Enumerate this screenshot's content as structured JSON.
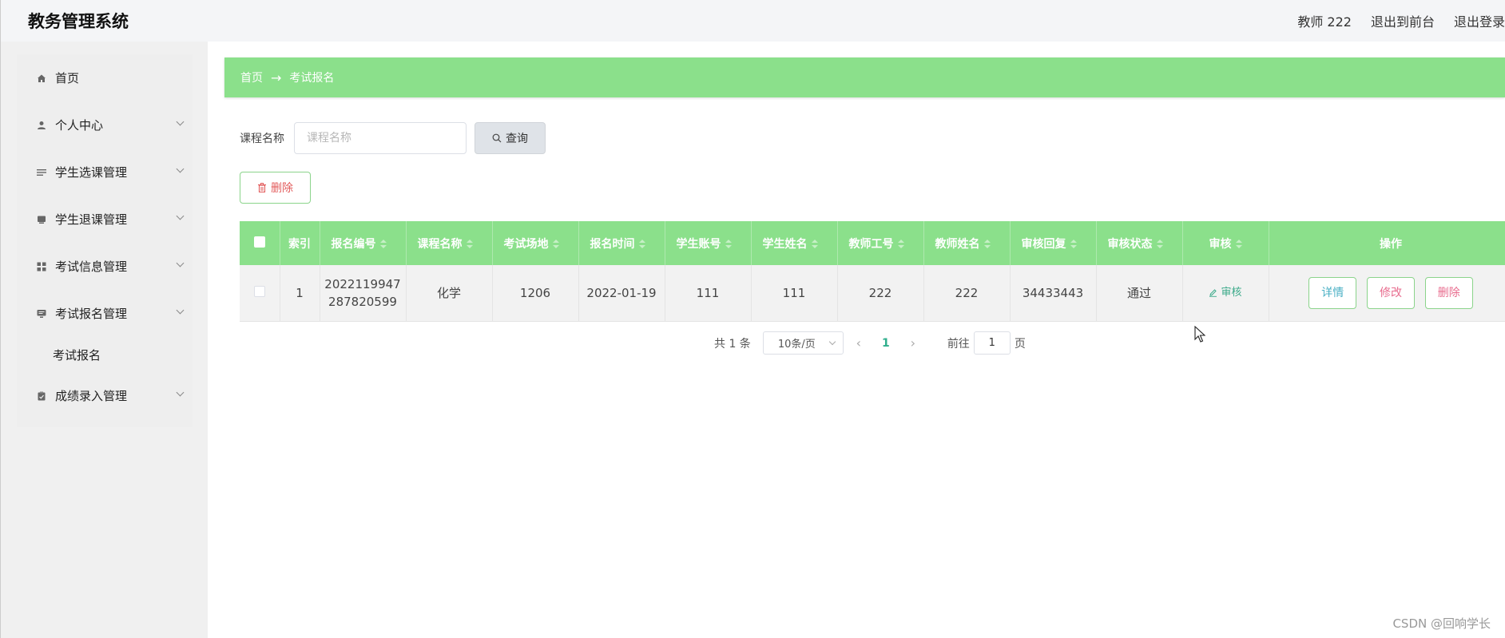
{
  "app": {
    "title": "教务管理系统",
    "user": "教师 222",
    "back_to_front": "退出到前台",
    "logout": "退出登录"
  },
  "sidebar": {
    "items": [
      {
        "label": "首页",
        "icon": "home-icon"
      },
      {
        "label": "个人中心",
        "icon": "user-icon"
      },
      {
        "label": "学生选课管理",
        "icon": "list-icon"
      },
      {
        "label": "学生退课管理",
        "icon": "box-icon"
      },
      {
        "label": "考试信息管理",
        "icon": "grid-icon"
      },
      {
        "label": "考试报名管理",
        "icon": "monitor-icon"
      },
      {
        "label": "考试报名"
      },
      {
        "label": "成绩录入管理",
        "icon": "clipboard-icon"
      }
    ]
  },
  "breadcrumb": {
    "home": "首页",
    "arrow": "→",
    "current": "考试报名"
  },
  "search": {
    "label": "课程名称",
    "placeholder": "课程名称",
    "button": "查询"
  },
  "toolbar": {
    "delete_label": "删除"
  },
  "table": {
    "headers": [
      "索引",
      "报名编号",
      "课程名称",
      "考试场地",
      "报名时间",
      "学生账号",
      "学生姓名",
      "教师工号",
      "教师姓名",
      "审核回复",
      "审核状态",
      "审核",
      "操作"
    ],
    "rows": [
      {
        "index": "1",
        "reg_no_line1": "2022119947",
        "reg_no_line2": "287820599",
        "course": "化学",
        "venue": "1206",
        "reg_time": "2022-01-19",
        "student_account": "111",
        "student_name": "111",
        "teacher_id": "222",
        "teacher_name": "222",
        "reply": "34433443",
        "status": "通过",
        "audit": "审核",
        "detail": "详情",
        "edit": "修改",
        "delete": "删除"
      }
    ]
  },
  "pagination": {
    "total": "共 1 条",
    "page_size": "10条/页",
    "current_page": "1",
    "goto_label": "前往",
    "goto_value": "1",
    "page_unit": "页"
  },
  "watermark": "CSDN @回响学长",
  "colors": {
    "accent": "#8be08b",
    "danger": "#e25b5b",
    "link": "#3caa8a"
  }
}
